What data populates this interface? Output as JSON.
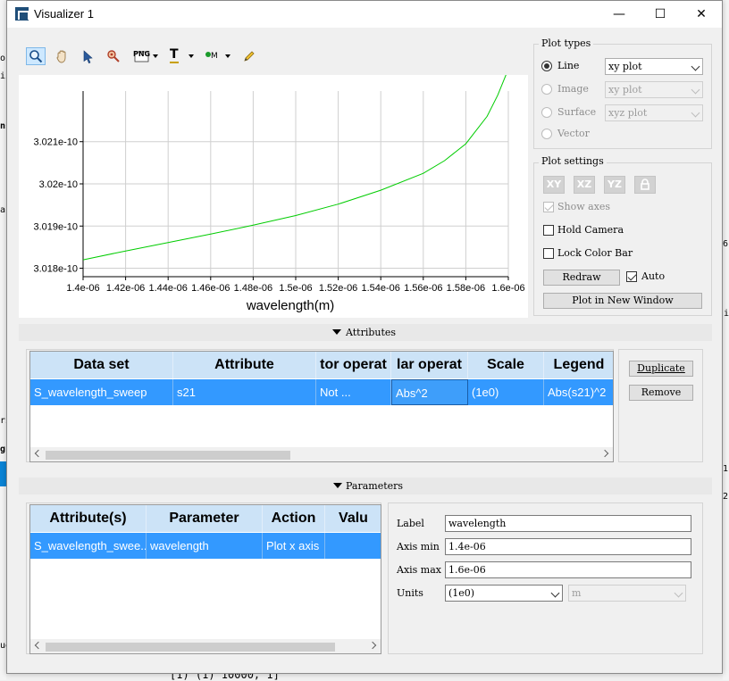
{
  "background": {
    "fragments": [
      "o",
      "ii",
      "ns",
      "a",
      "ri",
      "g",
      "ue"
    ],
    "bottom_text": "[1) (1) 10000, 1]",
    "right_fragments": [
      "6",
      "i",
      "1",
      "2"
    ]
  },
  "window": {
    "title": "Visualizer 1",
    "minimize": "—",
    "maximize": "☐",
    "close": "✕"
  },
  "toolbar": {
    "png_label": "PNG",
    "text_label": "T",
    "marker_label": "M"
  },
  "chart_data": {
    "type": "line",
    "title": "",
    "xlabel": "wavelength(m)",
    "ylabel": "",
    "xlim": [
      1.4e-06,
      1.6e-06
    ],
    "ylim": [
      3.0178e-10,
      3.0222e-10
    ],
    "x_ticks": [
      1.4e-06,
      1.42e-06,
      1.44e-06,
      1.46e-06,
      1.48e-06,
      1.5e-06,
      1.52e-06,
      1.54e-06,
      1.56e-06,
      1.58e-06,
      1.6e-06
    ],
    "x_tick_labels": [
      "1.4e-06",
      "1.42e-06",
      "1.44e-06",
      "1.46e-06",
      "1.48e-06",
      "1.5e-06",
      "1.52e-06",
      "1.54e-06",
      "1.56e-06",
      "1.58e-06",
      "1.6e-06"
    ],
    "y_ticks": [
      3.018e-10,
      3.019e-10,
      3.02e-10,
      3.021e-10
    ],
    "y_tick_labels": [
      "3.018e-10",
      "3.019e-10",
      "3.02e-10",
      "3.021e-10"
    ],
    "grid": true,
    "series": [
      {
        "color": "#00cc00",
        "x": [
          1.4e-06,
          1.42e-06,
          1.44e-06,
          1.46e-06,
          1.48e-06,
          1.5e-06,
          1.52e-06,
          1.54e-06,
          1.56e-06,
          1.57e-06,
          1.58e-06,
          1.59e-06,
          1.595e-06,
          1.6e-06
        ],
        "y": [
          3.0182e-10,
          3.01841e-10,
          3.01861e-10,
          3.01881e-10,
          3.01902e-10,
          3.01925e-10,
          3.01952e-10,
          3.01985e-10,
          3.02025e-10,
          3.02055e-10,
          3.02095e-10,
          3.0216e-10,
          3.0221e-10,
          3.02272e-10
        ]
      }
    ]
  },
  "plot_types": {
    "title": "Plot types",
    "items": [
      {
        "label": "Line",
        "selected": true,
        "enabled": true,
        "combo": "xy plot"
      },
      {
        "label": "Image",
        "selected": false,
        "enabled": false,
        "combo": "xy plot"
      },
      {
        "label": "Surface",
        "selected": false,
        "enabled": false,
        "combo": "xyz plot"
      },
      {
        "label": "Vector",
        "selected": false,
        "enabled": false
      }
    ]
  },
  "plot_settings": {
    "title": "Plot settings",
    "view_buttons": [
      "XY",
      "XZ",
      "YZ"
    ],
    "show_axes": "Show axes",
    "hold_camera": "Hold Camera",
    "lock_color_bar": "Lock Color Bar",
    "redraw": "Redraw",
    "auto": "Auto",
    "plot_new_window": "Plot in New Window"
  },
  "attributes": {
    "section_title": "Attributes",
    "columns": [
      "Data set",
      "Attribute",
      "tor operat",
      "lar operat",
      "Scale",
      "Legend"
    ],
    "rows": [
      [
        "S_wavelength_sweep",
        "s21",
        "Not ...",
        "Abs^2",
        "(1e0)",
        "Abs(s21)^2"
      ]
    ],
    "duplicate": "Duplicate",
    "remove": "Remove"
  },
  "parameters": {
    "section_title": "Parameters",
    "columns": [
      "Attribute(s)",
      "Parameter",
      "Action",
      "Valu"
    ],
    "rows": [
      [
        "S_wavelength_swee...",
        "wavelength",
        "Plot x axis",
        ""
      ]
    ],
    "label_label": "Label",
    "label_value": "wavelength",
    "axis_min_label": "Axis min",
    "axis_min_value": "1.4e-06",
    "axis_max_label": "Axis max",
    "axis_max_value": "1.6e-06",
    "units_label": "Units",
    "units_value": "(1e0)",
    "units_unit": "m"
  },
  "colors": {
    "selection": "#3399ff",
    "header": "#cce3f7",
    "line": "#00cc00"
  }
}
